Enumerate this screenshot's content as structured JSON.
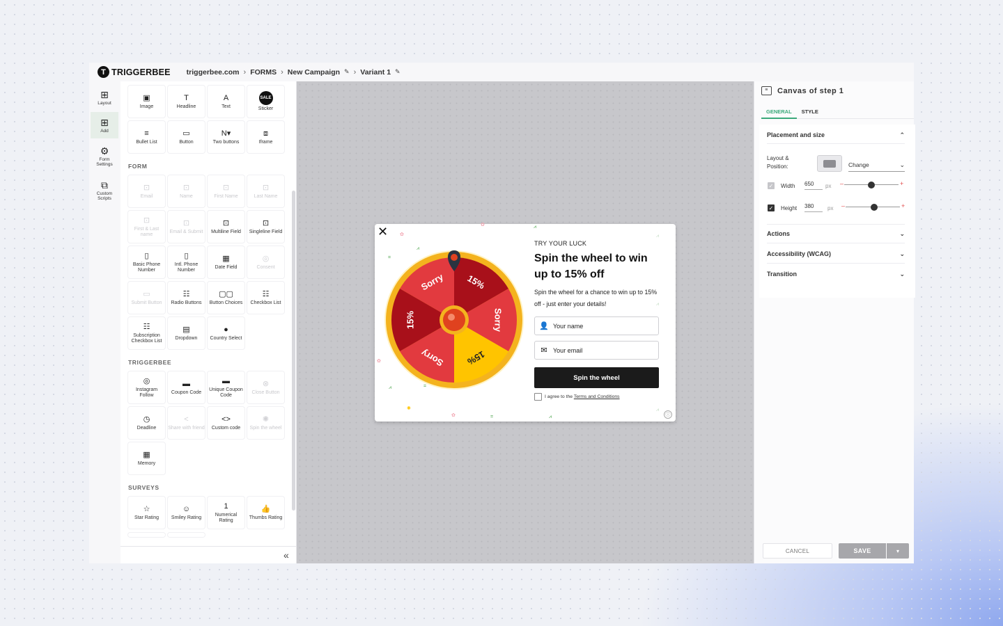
{
  "header": {
    "logo_mark": "T",
    "logo_text": "TRIGGERBEE",
    "breadcrumb": [
      "triggerbee.com",
      "FORMS",
      "New Campaign",
      "Variant 1"
    ]
  },
  "rail": [
    {
      "id": "layout",
      "icon": "layout-icon",
      "glyph": "⊞",
      "label": "Layout"
    },
    {
      "id": "add",
      "icon": "add-icon",
      "glyph": "⊞",
      "label": "Add"
    },
    {
      "id": "form-settings",
      "icon": "gear-icon",
      "glyph": "⚙",
      "label": "Form Settings"
    },
    {
      "id": "custom-scripts",
      "icon": "script-icon",
      "glyph": "⧉",
      "label": "Custom Scripts"
    }
  ],
  "palette": {
    "basic": [
      {
        "label": "Image",
        "icon": "image-icon",
        "glyph": "▣"
      },
      {
        "label": "Headline",
        "icon": "headline-icon",
        "glyph": "T"
      },
      {
        "label": "Text",
        "icon": "text-icon",
        "glyph": "A"
      },
      {
        "label": "Sticker",
        "icon": "sticker-icon",
        "glyph": "SALE"
      },
      {
        "label": "Bullet List",
        "icon": "bullet-list-icon",
        "glyph": "≡"
      },
      {
        "label": "Button",
        "icon": "button-icon",
        "glyph": "▭"
      },
      {
        "label": "Two buttons",
        "icon": "two-buttons-icon",
        "glyph": "N▾"
      },
      {
        "label": "Iframe",
        "icon": "iframe-icon",
        "glyph": "⧈"
      }
    ],
    "form_title": "FORM",
    "form": [
      {
        "label": "Email",
        "icon": "email-icon",
        "glyph": "⊡",
        "dim": true
      },
      {
        "label": "Name",
        "icon": "name-icon",
        "glyph": "⊡",
        "dim": true
      },
      {
        "label": "First Name",
        "icon": "first-name-icon",
        "glyph": "⊡",
        "dim": true
      },
      {
        "label": "Last Name",
        "icon": "last-name-icon",
        "glyph": "⊡",
        "dim": true
      },
      {
        "label": "First & Last name",
        "icon": "first-last-name-icon",
        "glyph": "⊡",
        "dim": true
      },
      {
        "label": "Email & Submit",
        "icon": "email-submit-icon",
        "glyph": "⊡",
        "dim": true
      },
      {
        "label": "Multiline Field",
        "icon": "multiline-field-icon",
        "glyph": "⊡"
      },
      {
        "label": "Singleline Field",
        "icon": "singleline-field-icon",
        "glyph": "⊡"
      },
      {
        "label": "Basic Phone Number",
        "icon": "phone-icon",
        "glyph": "▯"
      },
      {
        "label": "Intl. Phone Number",
        "icon": "intl-phone-icon",
        "glyph": "▯"
      },
      {
        "label": "Date Field",
        "icon": "calendar-icon",
        "glyph": "▦"
      },
      {
        "label": "Consent",
        "icon": "consent-icon",
        "glyph": "◎",
        "dim": true
      },
      {
        "label": "Submit Button",
        "icon": "submit-button-icon",
        "glyph": "▭",
        "dim": true
      },
      {
        "label": "Radio Buttons",
        "icon": "radio-buttons-icon",
        "glyph": "☷"
      },
      {
        "label": "Button Choices",
        "icon": "button-choices-icon",
        "glyph": "▢▢"
      },
      {
        "label": "Checkbox List",
        "icon": "checkbox-list-icon",
        "glyph": "☷"
      },
      {
        "label": "Subscription Checkbox List",
        "icon": "subscription-checkbox-icon",
        "glyph": "☷"
      },
      {
        "label": "Dropdown",
        "icon": "dropdown-icon",
        "glyph": "▤"
      },
      {
        "label": "Country Select",
        "icon": "globe-icon",
        "glyph": "●"
      }
    ],
    "triggerbee_title": "TRIGGERBEE",
    "triggerbee": [
      {
        "label": "Instagram Follow",
        "icon": "instagram-icon",
        "glyph": "◎"
      },
      {
        "label": "Coupon Code",
        "icon": "coupon-icon",
        "glyph": "▬"
      },
      {
        "label": "Unique Coupon Code",
        "icon": "unique-coupon-icon",
        "glyph": "▬"
      },
      {
        "label": "Close Button",
        "icon": "close-button-icon",
        "glyph": "⊗",
        "dim": true
      },
      {
        "label": "Deadline",
        "icon": "clock-icon",
        "glyph": "◷"
      },
      {
        "label": "Share with friend",
        "icon": "share-icon",
        "glyph": "<",
        "dim": true
      },
      {
        "label": "Custom code",
        "icon": "code-icon",
        "glyph": "<>"
      },
      {
        "label": "Spin the wheel",
        "icon": "wheel-icon",
        "glyph": "✺",
        "dim": true
      },
      {
        "label": "Memory",
        "icon": "memory-icon",
        "glyph": "▦"
      }
    ],
    "surveys_title": "SURVEYS",
    "surveys": [
      {
        "label": "Star Rating",
        "icon": "star-icon",
        "glyph": "☆"
      },
      {
        "label": "Smiley Rating",
        "icon": "smiley-icon",
        "glyph": "☺"
      },
      {
        "label": "Numerical Rating",
        "icon": "numerical-rating-icon",
        "glyph": "1"
      },
      {
        "label": "Thumbs Rating",
        "icon": "thumbs-icon",
        "glyph": "👍"
      }
    ],
    "collapse": "«"
  },
  "popup": {
    "kicker": "TRY YOUR LUCK",
    "headline": "Spin the wheel to win up to 15% off",
    "subtext": "Spin the wheel for a chance to win up to 15% off - just enter your details!",
    "name_placeholder": "Your name",
    "email_placeholder": "Your email",
    "spin_button": "Spin the wheel",
    "agree_text": "I agree to the ",
    "terms_link": "Terms and Conditions",
    "wheel_segments": [
      "Sorry",
      "15%",
      "Sorry",
      "15%",
      "Sorry",
      "15%"
    ],
    "wheel_colors": {
      "red": "#e23a3f",
      "dark_red": "#a8101a",
      "yellow": "#ffc400",
      "rim": "#f4b31e"
    }
  },
  "panel": {
    "title": "Canvas of step 1",
    "tabs": [
      "GENERAL",
      "STYLE"
    ],
    "placement_title": "Placement and size",
    "layout_label": "Layout & Position:",
    "change_label": "Change",
    "width_label": "Width",
    "width_value": "650",
    "width_checked": false,
    "height_label": "Height",
    "height_value": "380",
    "height_checked": true,
    "unit": "px",
    "width_slider": 0.5,
    "height_slider": 0.53,
    "sections": [
      "Actions",
      "Accessibility (WCAG)",
      "Transition"
    ],
    "cancel": "CANCEL",
    "save": "SAVE"
  },
  "colors": {
    "accent": "#3aa97a",
    "save_disabled": "#a7a7ab"
  }
}
